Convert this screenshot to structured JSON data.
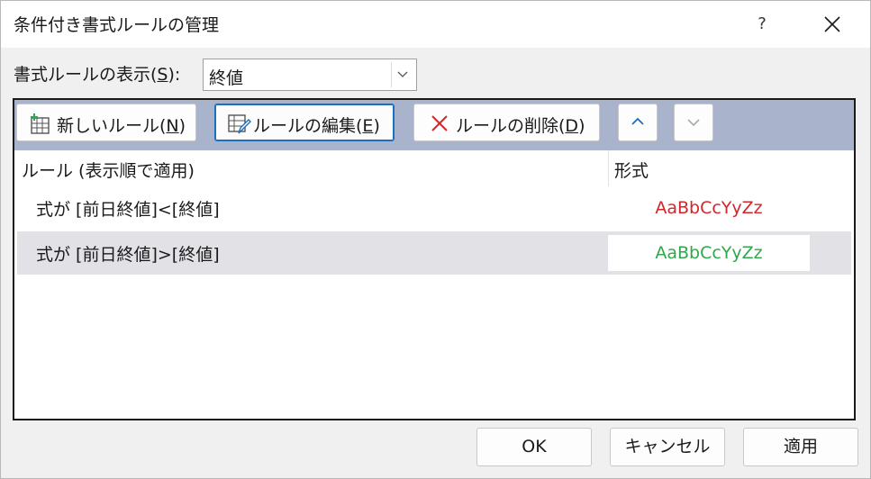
{
  "window": {
    "title": "条件付き書式ルールの管理",
    "help_glyph": "?",
    "close_icon": "close-icon"
  },
  "show_rules": {
    "label": "書式ルールの表示(",
    "label_key": "S",
    "label_end": "):",
    "selected": "終値"
  },
  "toolbar": {
    "new_rule": {
      "label": "新しいルール(",
      "key": "N",
      "end": ")"
    },
    "edit_rule": {
      "label": "ルールの編集(",
      "key": "E",
      "end": ")"
    },
    "delete_rule": {
      "label": "ルールの削除(",
      "key": "D",
      "end": ")"
    }
  },
  "columns": {
    "rule": "ルール (表示順で適用)",
    "format": "形式"
  },
  "rules": [
    {
      "condition": "式が [前日終値]<[終値]",
      "preview": "AaBbCcYyZz",
      "preview_color": "#d1262b"
    },
    {
      "condition": "式が [前日終値]>[終値]",
      "preview": "AaBbCcYyZz",
      "preview_color": "#2ea84a"
    }
  ],
  "footer": {
    "ok": "OK",
    "cancel": "キャンセル",
    "apply": "適用"
  },
  "colors": {
    "toolbar_bg": "#a9b4cc",
    "selected_row": "#e1e1e6",
    "focus_border": "#1a6fbf",
    "rule_1": "#d1262b",
    "rule_2": "#2ea84a"
  }
}
